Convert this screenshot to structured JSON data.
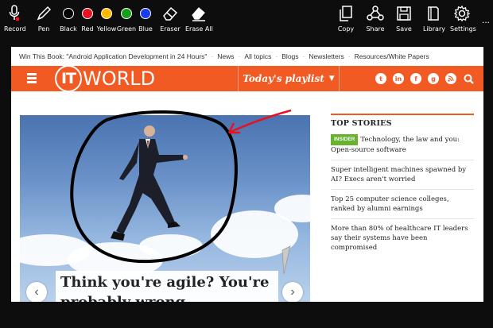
{
  "toolbar": {
    "left_tools": [
      {
        "label": "Record",
        "icon": "microphone-icon"
      },
      {
        "label": "Pen",
        "icon": "pen-icon"
      },
      {
        "label": "Black",
        "color": "#000000"
      },
      {
        "label": "Red",
        "color": "#e81123"
      },
      {
        "label": "Yellow",
        "color": "#ffb900"
      },
      {
        "label": "Green",
        "color": "#16a01a"
      },
      {
        "label": "Blue",
        "color": "#1a3cf0"
      },
      {
        "label": "Eraser",
        "icon": "eraser-icon"
      },
      {
        "label": "Erase All",
        "icon": "erase-all-icon"
      }
    ],
    "right_tools": [
      {
        "label": "Copy",
        "icon": "copy-icon"
      },
      {
        "label": "Share",
        "icon": "share-icon"
      },
      {
        "label": "Save",
        "icon": "save-icon"
      },
      {
        "label": "Library",
        "icon": "library-icon"
      },
      {
        "label": "Settings",
        "icon": "gear-icon"
      }
    ],
    "more": "..."
  },
  "site": {
    "topline": [
      "Win This Book: \"Android Application Development in 24 Hours\"",
      "News",
      "All topics",
      "Blogs",
      "Newsletters",
      "Resources/White Papers"
    ],
    "logo_circle": "IT",
    "logo_word": "WORLD",
    "playlist_label": "Today's playlist",
    "social": [
      "twitter-icon",
      "linkedin-icon",
      "facebook-icon",
      "googleplus-icon",
      "rss-icon",
      "search-icon"
    ],
    "accent": "#f15a22"
  },
  "hero": {
    "title": "Think you're agile? You're probably wrong"
  },
  "top_stories": {
    "heading": "TOP STORIES",
    "badge": "INSIDER",
    "items": [
      "Technology, the law and you: Open-source software",
      "Super intelligent machines spawned by AI? Execs aren't worried",
      "Top 25 computer science colleges, ranked by alumni earnings",
      "More than 80% of healthcare IT leaders say their systems have been compromised"
    ]
  },
  "annotation": {
    "circle_color": "#000000",
    "arrow_color": "#e81123"
  }
}
